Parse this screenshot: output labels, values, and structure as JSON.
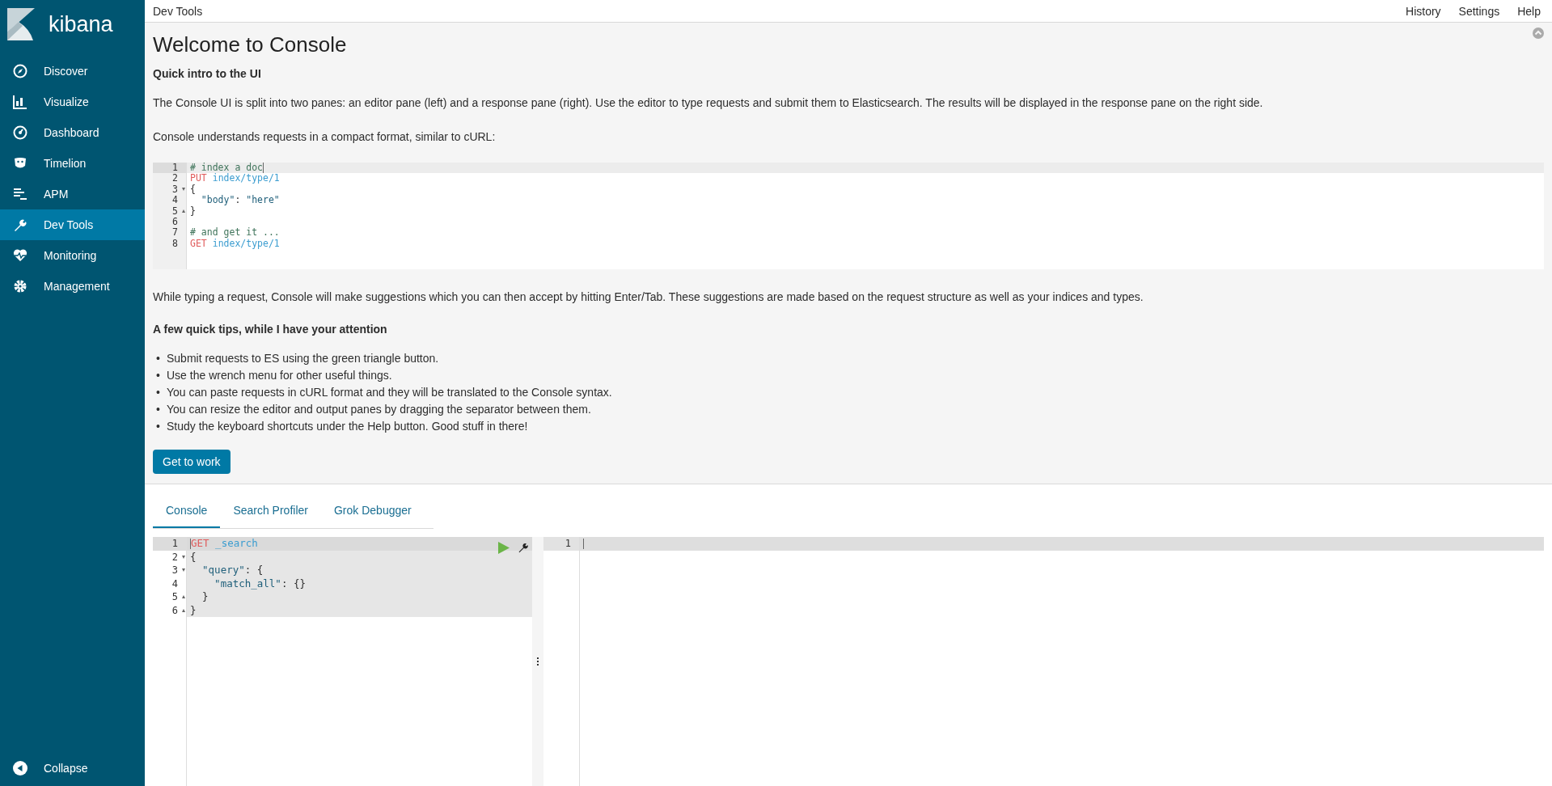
{
  "sidebar": {
    "brand": "kibana",
    "items": [
      {
        "label": "Discover",
        "selected": false
      },
      {
        "label": "Visualize",
        "selected": false
      },
      {
        "label": "Dashboard",
        "selected": false
      },
      {
        "label": "Timelion",
        "selected": false
      },
      {
        "label": "APM",
        "selected": false
      },
      {
        "label": "Dev Tools",
        "selected": true
      },
      {
        "label": "Monitoring",
        "selected": false
      },
      {
        "label": "Management",
        "selected": false
      }
    ],
    "collapse": "Collapse"
  },
  "top_bar": {
    "title": "Dev Tools",
    "links": [
      "History",
      "Settings",
      "Help"
    ]
  },
  "welcome": {
    "title": "Welcome to Console",
    "subtitle": "Quick intro to the UI",
    "intro": "The Console UI is split into two panes: an editor pane (left) and a response pane (right). Use the editor to type requests and submit them to Elasticsearch. The results will be displayed in the response pane on the right side.",
    "format_note": "Console understands requests in a compact format, similar to cURL:",
    "example": [
      {
        "number": "1",
        "tokens": [
          {
            "text": "# index a doc",
            "kind": "comment"
          }
        ]
      },
      {
        "number": "2",
        "tokens": [
          {
            "text": "PUT",
            "kind": "method"
          },
          {
            "text": " index/type/1",
            "kind": "url"
          }
        ]
      },
      {
        "number": "3",
        "fold": "▾",
        "tokens": [
          {
            "text": "{",
            "kind": "paren"
          }
        ]
      },
      {
        "number": "4",
        "tokens": [
          {
            "text": "  \"body\"",
            "kind": "key"
          },
          {
            "text": ": ",
            "kind": "plain"
          },
          {
            "text": "\"here\"",
            "kind": "string"
          }
        ]
      },
      {
        "number": "5",
        "fold": "▴",
        "tokens": [
          {
            "text": "}",
            "kind": "paren"
          }
        ]
      },
      {
        "number": "6"
      },
      {
        "number": "7",
        "tokens": [
          {
            "text": "# and get it ...",
            "kind": "comment"
          }
        ]
      },
      {
        "number": "8",
        "tokens": [
          {
            "text": "GET",
            "kind": "method"
          },
          {
            "text": " index/type/1",
            "kind": "url"
          }
        ]
      }
    ],
    "suggestions": "While typing a request, Console will make suggestions which you can then accept by hitting Enter/Tab. These suggestions are made based on the request structure as well as your indices and types.",
    "tips_title": "A few quick tips, while I have your attention",
    "tips": [
      {
        "bullet": "•",
        "text": "Submit requests to ES using the green triangle button."
      },
      {
        "bullet": "•",
        "text": "Use the wrench menu for other useful things."
      },
      {
        "bullet": "•",
        "text": "You can paste requests in cURL format and they will be translated to the Console syntax."
      },
      {
        "bullet": "•",
        "text": "You can resize the editor and output panes by dragging the separator between them."
      },
      {
        "bullet": "•",
        "text": "Study the keyboard shortcuts under the Help button. Good stuff in there!"
      }
    ],
    "button": "Get to work"
  },
  "tabs": [
    {
      "label": "Console",
      "selected": true
    },
    {
      "label": "Search Profiler",
      "selected": false
    },
    {
      "label": "Grok Debugger",
      "selected": false
    }
  ],
  "editor": {
    "lines": [
      {
        "number": "1",
        "tokens": [
          {
            "text": "GET",
            "kind": "method"
          },
          {
            "text": " _search",
            "kind": "url"
          }
        ]
      },
      {
        "number": "2",
        "fold": "▾",
        "tokens": [
          {
            "text": "{",
            "kind": "paren"
          }
        ]
      },
      {
        "number": "3",
        "fold": "▾",
        "tokens": [
          {
            "text": "  \"query\"",
            "kind": "key"
          },
          {
            "text": ": ",
            "kind": "plain"
          },
          {
            "text": "{",
            "kind": "paren"
          }
        ]
      },
      {
        "number": "4",
        "tokens": [
          {
            "text": "    \"match_all\"",
            "kind": "key"
          },
          {
            "text": ": ",
            "kind": "plain"
          },
          {
            "text": "{}",
            "kind": "paren"
          }
        ]
      },
      {
        "number": "5",
        "fold": "▴",
        "tokens": [
          {
            "text": "  }",
            "kind": "paren"
          }
        ]
      },
      {
        "number": "6",
        "fold": "▴",
        "tokens": [
          {
            "text": "}",
            "kind": "paren"
          }
        ]
      }
    ]
  },
  "response": {
    "lines": [
      {
        "number": "1"
      }
    ]
  }
}
